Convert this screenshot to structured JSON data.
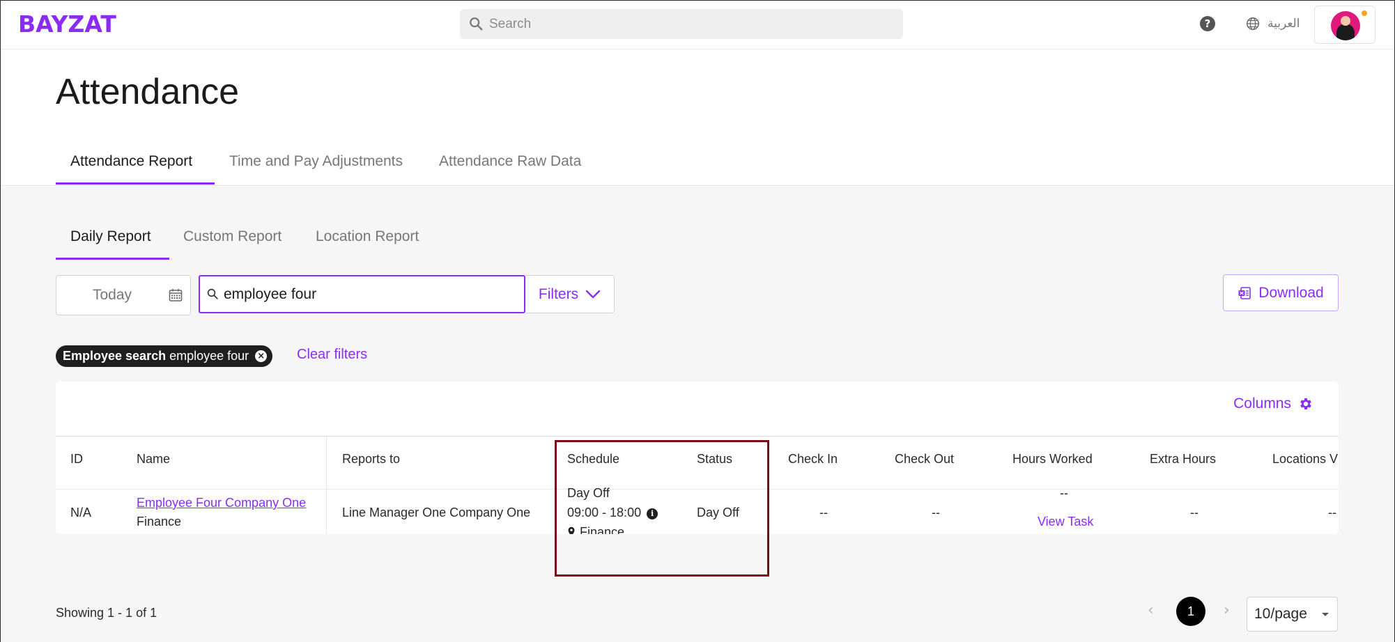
{
  "app": {
    "logo": "BAYZAT"
  },
  "topbar": {
    "search_placeholder": "Search",
    "help_symbol": "?",
    "language_label": "العربية"
  },
  "page": {
    "title": "Attendance"
  },
  "tabs": [
    {
      "label": "Attendance Report",
      "active": true
    },
    {
      "label": "Time and Pay Adjustments",
      "active": false
    },
    {
      "label": "Attendance Raw Data",
      "active": false
    }
  ],
  "subtabs": [
    {
      "label": "Daily Report",
      "active": true
    },
    {
      "label": "Custom Report",
      "active": false
    },
    {
      "label": "Location Report",
      "active": false
    }
  ],
  "filters": {
    "date_value": "Today",
    "employee_search_value": "employee four",
    "filters_label": "Filters",
    "download_label": "Download",
    "active_chip": {
      "key": "Employee search",
      "value": "employee four"
    },
    "clear_label": "Clear filters"
  },
  "table": {
    "columns_label": "Columns",
    "headers": {
      "id": "ID",
      "name": "Name",
      "reports_to": "Reports to",
      "schedule": "Schedule",
      "status": "Status",
      "check_in": "Check In",
      "check_out": "Check Out",
      "hours_worked": "Hours Worked",
      "extra_hours": "Extra Hours",
      "locations": "Locations V"
    },
    "rows": [
      {
        "id": "N/A",
        "name": "Employee Four Company One",
        "department": "Finance",
        "reports_to": "Line Manager One Company One",
        "schedule_type": "Day Off",
        "schedule_time": "09:00 - 18:00",
        "schedule_location": "Finance",
        "status": "Day Off",
        "check_in": "--",
        "check_out": "--",
        "hours_worked": "--",
        "view_task_label": "View Task",
        "extra_hours": "--",
        "locations": "--"
      }
    ]
  },
  "pagination": {
    "showing_text": "Showing 1 - 1 of 1",
    "prev_symbol": "‹",
    "current_page": "1",
    "next_symbol": "›",
    "page_size": "10/page"
  },
  "colors": {
    "accent": "#8b2cf5",
    "highlight": "#7a0f1c"
  }
}
